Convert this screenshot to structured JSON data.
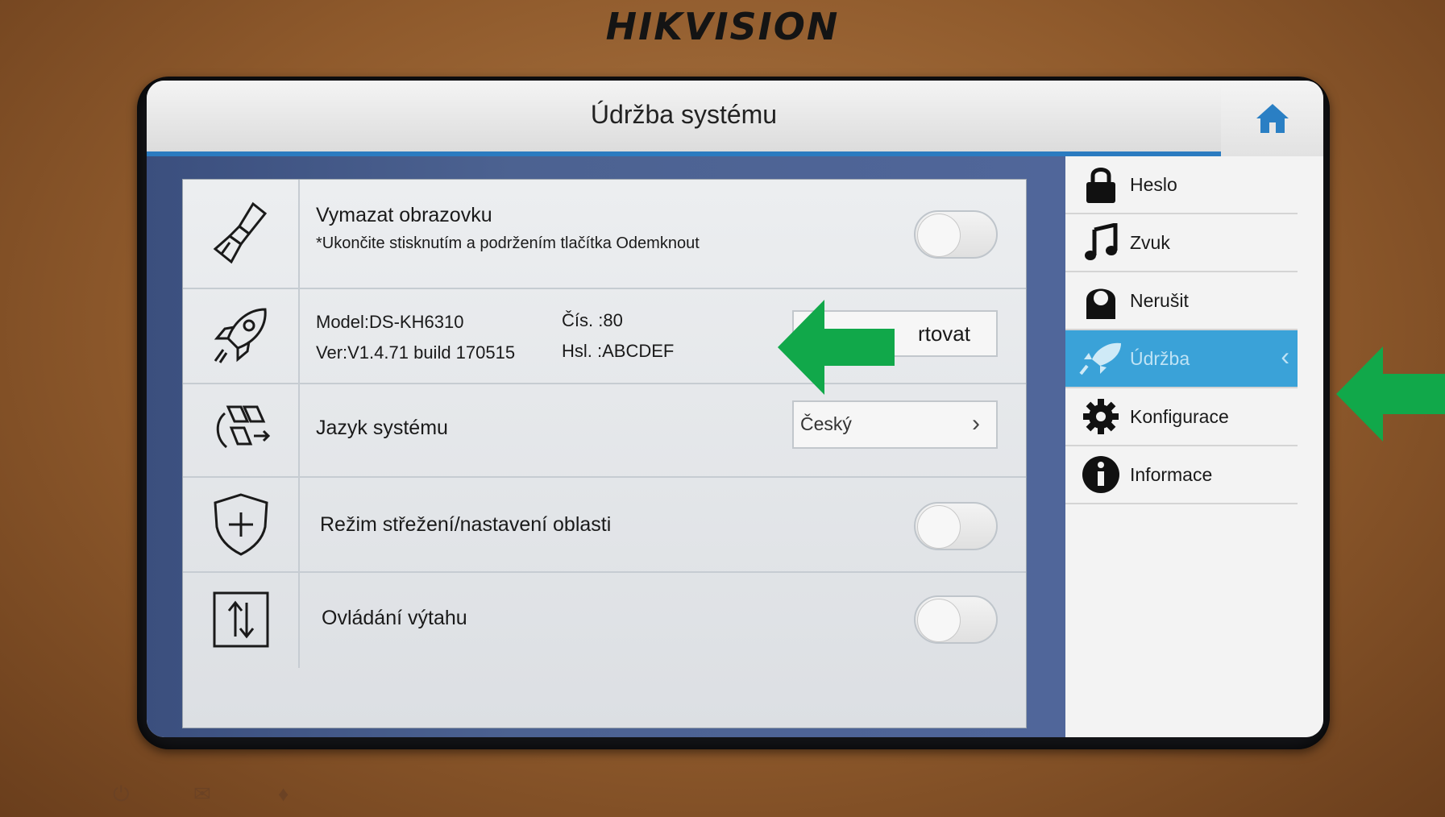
{
  "device": {
    "brand": "HIKVISION"
  },
  "header": {
    "title": "Údržba systému",
    "home_icon": "home-icon"
  },
  "rows": [
    {
      "title": "Vymazat obrazovku",
      "subtitle": "*Ukončite stisknutím a podržením tlačítka Odemknout",
      "icon": "brush-icon",
      "toggle": "off"
    },
    {
      "model": "Model:DS-KH6310",
      "version": "Ver:V1.4.71 build 170515",
      "serial": "Čís. :80",
      "hsl": "Hsl. :ABCDEF",
      "button_label": "rtovat",
      "icon": "rocket-icon"
    },
    {
      "title": "Jazyk systému",
      "value": "Český",
      "icon": "language-icon"
    },
    {
      "title": "Režim střežení/nastavení oblasti",
      "icon": "shield-plus-icon",
      "toggle": "off"
    },
    {
      "title": "Ovládání výtahu",
      "icon": "elevator-icon",
      "toggle": "off"
    }
  ],
  "sidebar": {
    "items": [
      {
        "label": "Heslo",
        "icon": "lock-icon",
        "active": false
      },
      {
        "label": "Zvuk",
        "icon": "music-note-icon",
        "active": false
      },
      {
        "label": "Nerušit",
        "icon": "do-not-disturb-icon",
        "active": false
      },
      {
        "label": "Údržba",
        "icon": "rocket-icon",
        "active": true
      },
      {
        "label": "Konfigurace",
        "icon": "gear-icon",
        "active": false
      },
      {
        "label": "Informace",
        "icon": "info-icon",
        "active": false
      }
    ]
  },
  "annotations": {
    "arrow_color": "#11a84a"
  },
  "colors": {
    "accent": "#3aa2d8",
    "header_line": "#2b7bc0"
  }
}
